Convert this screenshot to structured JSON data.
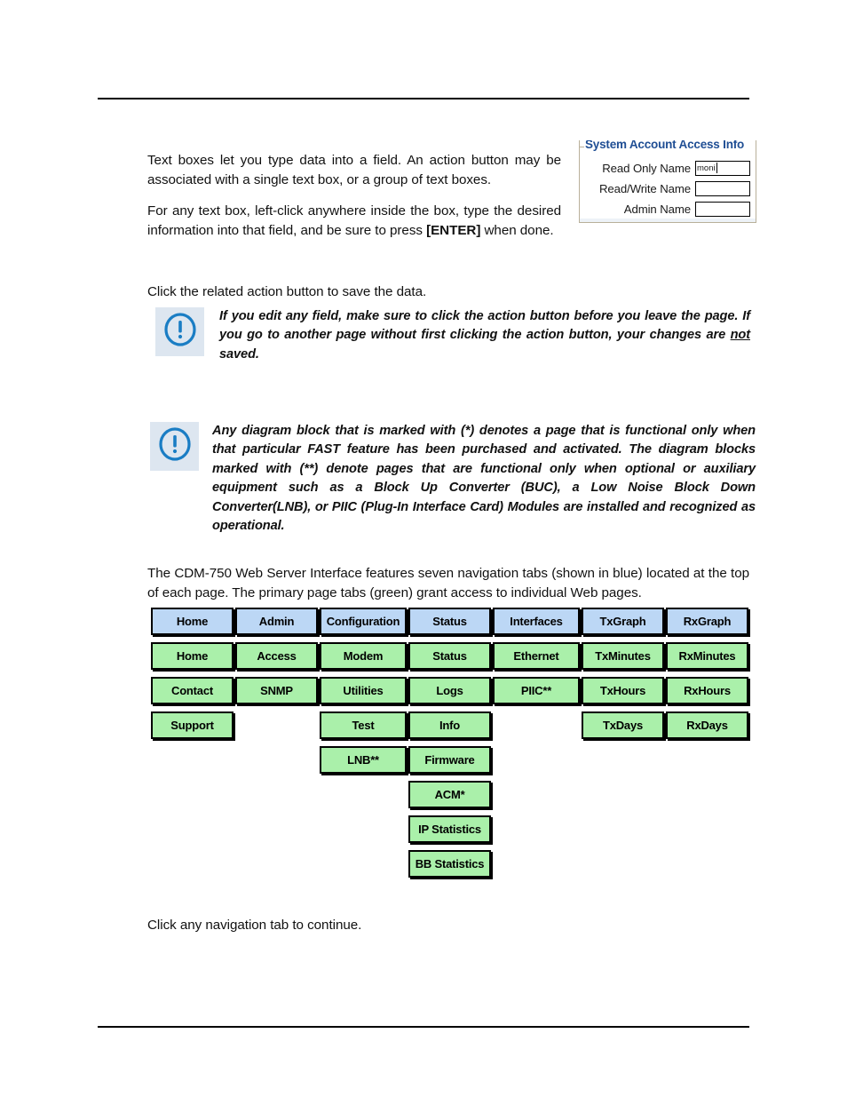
{
  "paragraphs": {
    "textboxes_intro": "Text boxes let you type data into a field. An action button may be associated with a single text box, or a group of text boxes.",
    "any_textbox_pre": "For any text box, left-click anywhere inside the box, type the desired information into that field, and be sure to press ",
    "any_textbox_bold": "[ENTER]",
    "any_textbox_post": " when done.",
    "click_related": "Click the related action button to save the data.",
    "cdm_intro": "The CDM-750 Web Server Interface features seven navigation tabs (shown in blue) located at the top of each page. The primary page tabs (green) grant access to individual Web pages.",
    "click_nav": "Click any navigation tab to continue."
  },
  "notes": [
    {
      "icon": "info-exclamation-icon",
      "text_pre": "If you edit any field, make sure to click the action button before you leave the page. If you go to another page without first clicking the action button, your changes are ",
      "text_underline": "not",
      "text_post": " saved."
    },
    {
      "icon": "info-exclamation-icon",
      "text_pre": "Any diagram block that is marked with (*) denotes a page that is functional only when that particular FAST feature has been purchased and activated. The diagram blocks marked with (**) denote pages that are functional only when optional or auxiliary equipment such as a Block Up Converter (BUC), a Low Noise Block Down Converter(LNB), or PIIC (Plug-In Interface Card) Modules are installed and recognized as operational.",
      "text_underline": "",
      "text_post": ""
    }
  ],
  "system_account_panel": {
    "legend": "System Account Access Info",
    "fields": [
      {
        "label": "Read Only Name",
        "value": "moni",
        "focused": true
      },
      {
        "label": "Read/Write Name",
        "value": "",
        "focused": false
      },
      {
        "label": "Admin Name",
        "value": "",
        "focused": false
      }
    ]
  },
  "nav_diagram": {
    "colors": {
      "nav_tab": "#bcd7f5",
      "page_tab": "#aaf0aa",
      "border": "#000000"
    },
    "columns": [
      {
        "nav_tab": "Home",
        "page_tabs": [
          "Home",
          "Contact",
          "Support"
        ]
      },
      {
        "nav_tab": "Admin",
        "page_tabs": [
          "Access",
          "SNMP"
        ]
      },
      {
        "nav_tab": "Configuration",
        "page_tabs": [
          "Modem",
          "Utilities",
          "Test",
          "LNB**"
        ]
      },
      {
        "nav_tab": "Status",
        "page_tabs": [
          "Status",
          "Logs",
          "Info",
          "Firmware",
          "ACM*",
          "IP Statistics",
          "BB Statistics"
        ]
      },
      {
        "nav_tab": "Interfaces",
        "page_tabs": [
          "Ethernet",
          "PIIC**"
        ]
      },
      {
        "nav_tab": "TxGraph",
        "page_tabs": [
          "TxMinutes",
          "TxHours",
          "TxDays"
        ]
      },
      {
        "nav_tab": "RxGraph",
        "page_tabs": [
          "RxMinutes",
          "RxHours",
          "RxDays"
        ]
      }
    ]
  }
}
